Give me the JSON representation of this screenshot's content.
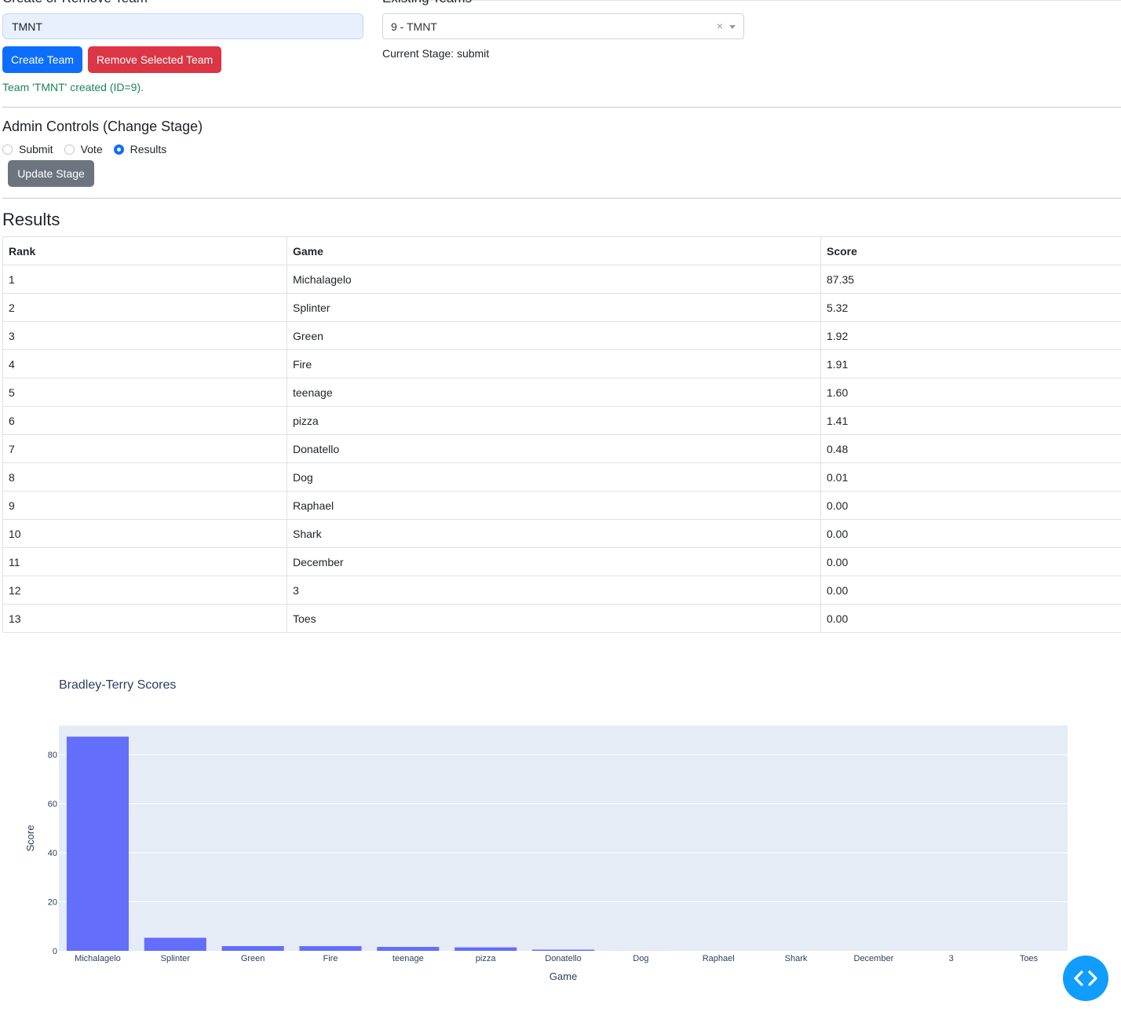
{
  "create_section": {
    "heading": "Create or Remove Team",
    "team_name_value": "TMNT",
    "create_button": "Create Team",
    "remove_button": "Remove Selected Team",
    "message": "Team 'TMNT' created (ID=9)."
  },
  "existing_section": {
    "heading": "Existing Teams",
    "selected_team": "9 - TMNT",
    "clear_glyph": "×",
    "current_stage": "Current Stage: submit"
  },
  "admin": {
    "title": "Admin Controls (Change Stage)",
    "options": [
      {
        "label": "Submit",
        "checked": false
      },
      {
        "label": "Vote",
        "checked": false
      },
      {
        "label": "Results",
        "checked": true
      }
    ],
    "update_button": "Update Stage"
  },
  "results": {
    "title": "Results",
    "headers": [
      "Rank",
      "Game",
      "Score"
    ],
    "rows": [
      [
        "1",
        "Michalagelo",
        "87.35"
      ],
      [
        "2",
        "Splinter",
        "5.32"
      ],
      [
        "3",
        "Green",
        "1.92"
      ],
      [
        "4",
        "Fire",
        "1.91"
      ],
      [
        "5",
        "teenage",
        "1.60"
      ],
      [
        "6",
        "pizza",
        "1.41"
      ],
      [
        "7",
        "Donatello",
        "0.48"
      ],
      [
        "8",
        "Dog",
        "0.01"
      ],
      [
        "9",
        "Raphael",
        "0.00"
      ],
      [
        "10",
        "Shark",
        "0.00"
      ],
      [
        "11",
        "December",
        "0.00"
      ],
      [
        "12",
        "3",
        "0.00"
      ],
      [
        "13",
        "Toes",
        "0.00"
      ]
    ]
  },
  "chart_data": {
    "type": "bar",
    "title": "Bradley-Terry Scores",
    "xlabel": "Game",
    "ylabel": "Score",
    "categories": [
      "Michalagelo",
      "Splinter",
      "Green",
      "Fire",
      "teenage",
      "pizza",
      "Donatello",
      "Dog",
      "Raphael",
      "Shark",
      "December",
      "3",
      "Toes"
    ],
    "values": [
      87.35,
      5.32,
      1.92,
      1.91,
      1.6,
      1.41,
      0.48,
      0.01,
      0.0,
      0.0,
      0.0,
      0.0,
      0.0
    ],
    "yticks": [
      0,
      20,
      40,
      60,
      80
    ],
    "ylim": [
      0,
      91.9
    ],
    "grid": true,
    "bar_color": "#636efa",
    "plot_bg": "#e5ecf6"
  },
  "fab": {
    "icon": "code-icon"
  },
  "colors": {
    "primary": "#0d6efd",
    "danger": "#dc3545",
    "secondary": "#6c757d",
    "success": "#198754",
    "fab": "#119dff"
  }
}
